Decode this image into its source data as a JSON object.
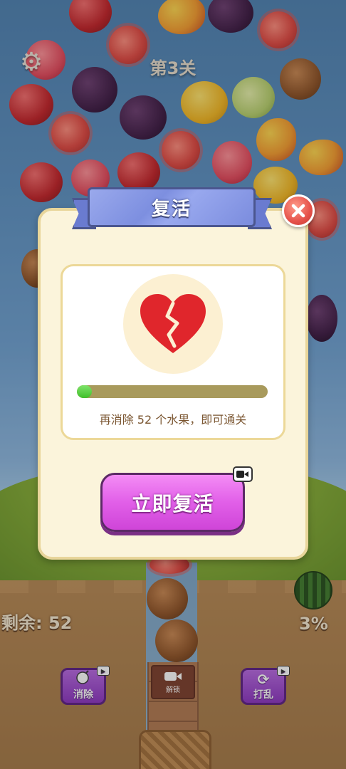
{
  "hud": {
    "level_label": "第3关",
    "remaining_label": "剩余: 52",
    "progress_percent_label": "3%"
  },
  "tools": {
    "eliminate_label": "消除",
    "shuffle_label": "打乱",
    "unlock_label": "解锁"
  },
  "dialog": {
    "title": "复活",
    "progress_value": 0.08,
    "hint": "再消除 52 个水果，即可通关",
    "revive_button": "立即复活"
  },
  "icons": {
    "settings": "gear-icon",
    "close": "close-icon",
    "broken_heart": "broken-heart-icon",
    "video_ad": "video-camera-icon",
    "bomb": "bomb-icon",
    "shuffle": "shuffle-icon"
  },
  "colors": {
    "panel_bg": "#fbf4db",
    "ribbon": "#8c9ce6",
    "revive_button": "#e15fe8",
    "progress_fill": "#4ccb35",
    "heart": "#e0262c"
  }
}
